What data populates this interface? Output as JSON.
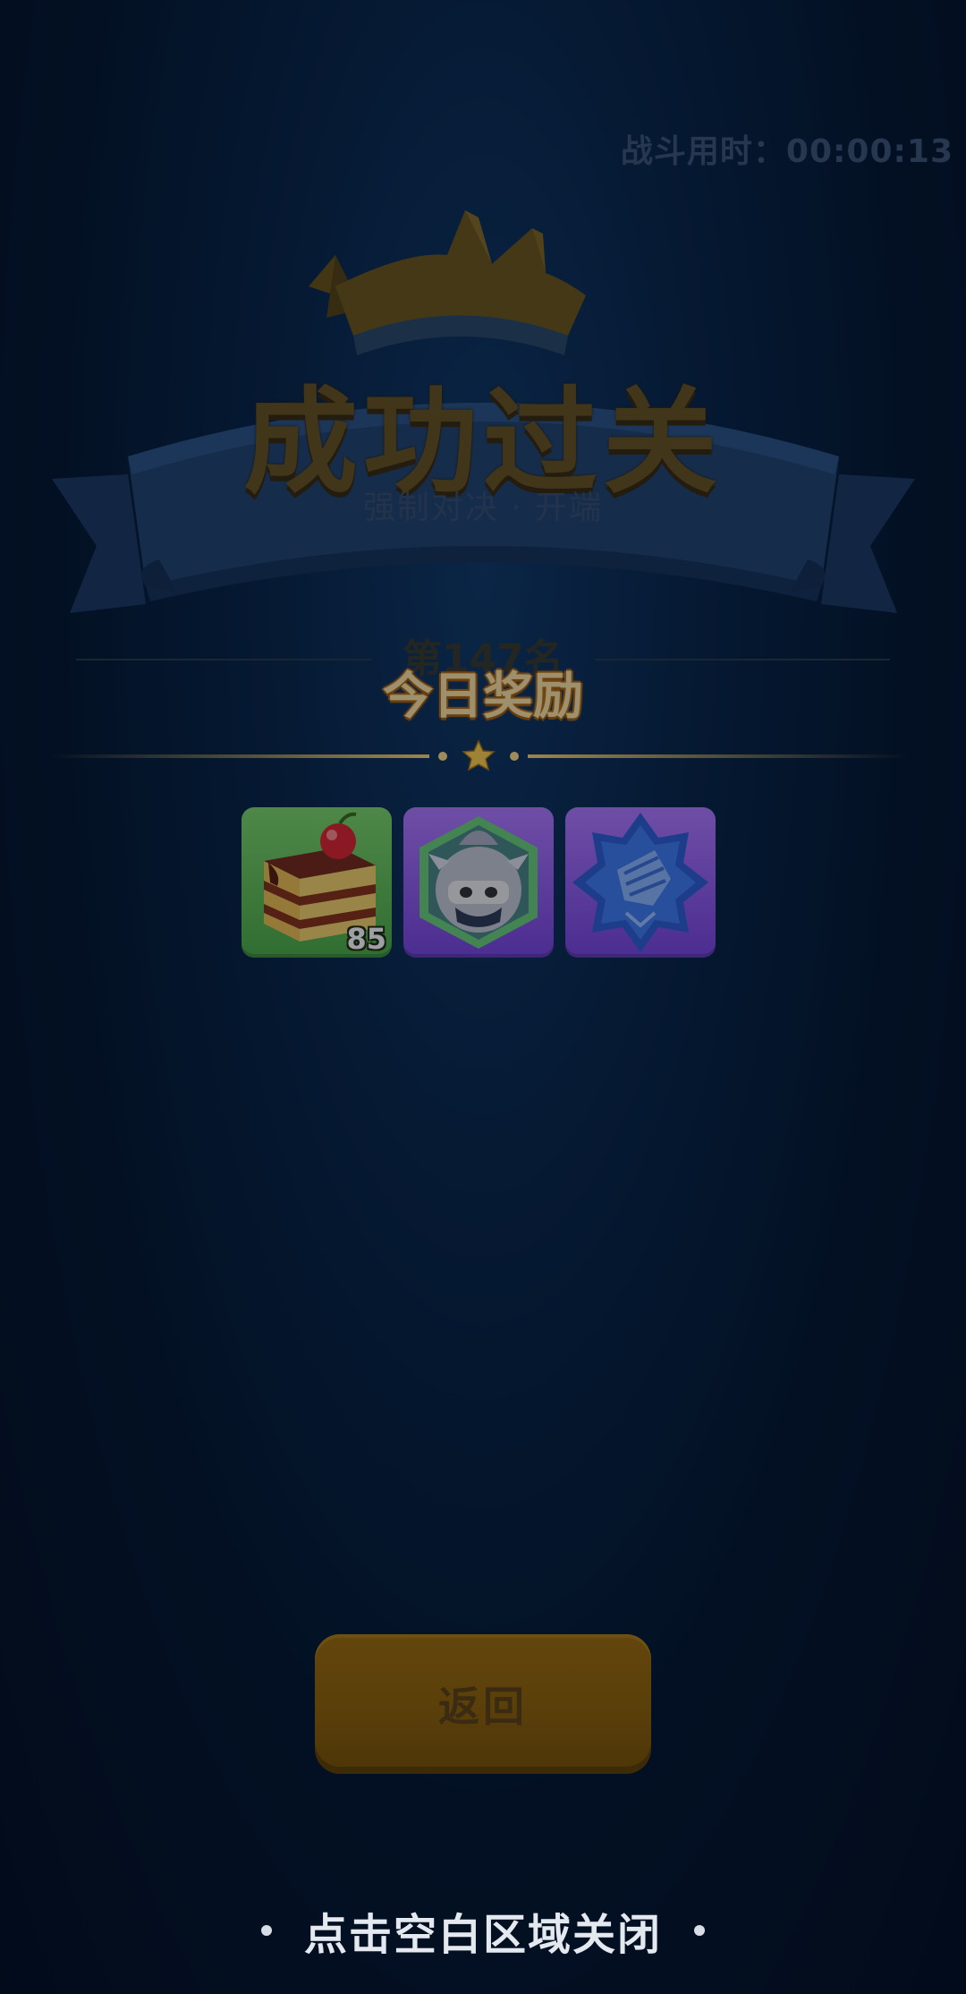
{
  "battle": {
    "timer_label": "战斗用时：",
    "timer_value": "00:00:13"
  },
  "result": {
    "title": "成功过关",
    "subtitle": "强制对决 · 开端",
    "rank": "第147名"
  },
  "rewards": {
    "title": "今日奖励",
    "items": [
      {
        "icon": "cake-icon",
        "background": "green",
        "count": "85"
      },
      {
        "icon": "knight-avatar-icon",
        "background": "purple"
      },
      {
        "icon": "fist-badge-icon",
        "background": "purple"
      }
    ]
  },
  "actions": {
    "back_label": "返回",
    "close_hint": "点击空白区域关闭"
  },
  "colors": {
    "background": "#06182f",
    "reward_title": "#ffe6a3",
    "button": "#5a3f0a",
    "green_tile": "#5dbb4f",
    "purple_tile": "#8f5cf0"
  }
}
